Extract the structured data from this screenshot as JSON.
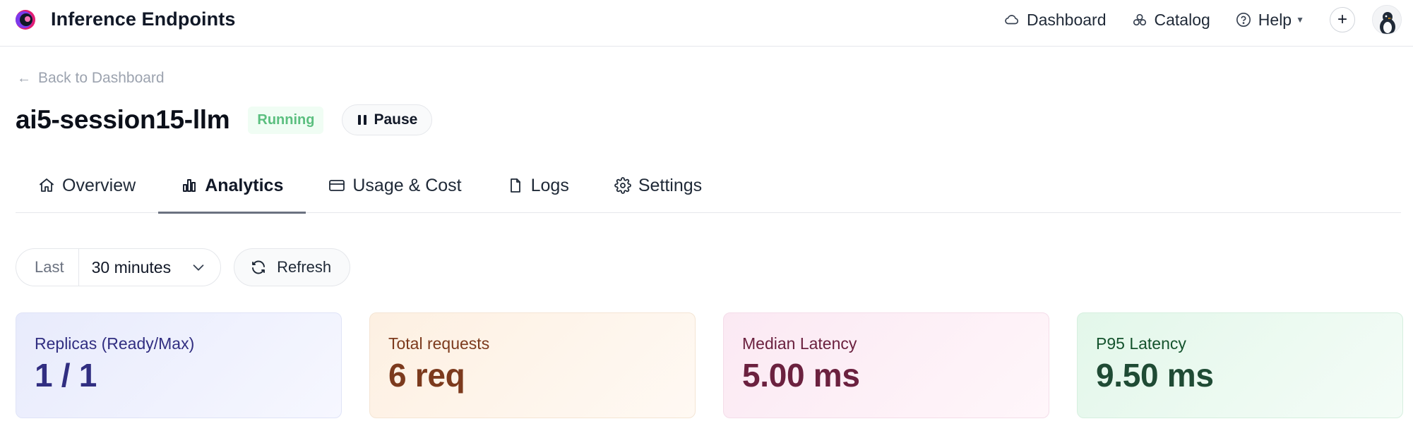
{
  "header": {
    "app_title": "Inference Endpoints",
    "logo_icon": "inference-endpoints-logo",
    "nav": [
      {
        "label": "Dashboard",
        "icon": "cloud-icon"
      },
      {
        "label": "Catalog",
        "icon": "catalog-icon"
      },
      {
        "label": "Help",
        "icon": "help-icon"
      }
    ],
    "add_icon": "plus-icon",
    "avatar_icon": "user-avatar"
  },
  "breadcrumb": {
    "back_label": "Back to Dashboard",
    "arrow": "←"
  },
  "endpoint": {
    "name": "ai5-session15-llm",
    "status": "Running",
    "status_color": "#5bbf7f",
    "pause_label": "Pause"
  },
  "tabs": [
    {
      "label": "Overview",
      "icon": "home-icon",
      "active": false
    },
    {
      "label": "Analytics",
      "icon": "bar-chart-icon",
      "active": true
    },
    {
      "label": "Usage & Cost",
      "icon": "credit-card-icon",
      "active": false
    },
    {
      "label": "Logs",
      "icon": "file-icon",
      "active": false
    },
    {
      "label": "Settings",
      "icon": "gear-icon",
      "active": false
    }
  ],
  "controls": {
    "range_prefix": "Last",
    "range_value": "30 minutes",
    "refresh_label": "Refresh"
  },
  "metrics": [
    {
      "label": "Replicas (Ready/Max)",
      "value": "1 / 1",
      "color": "#312e81"
    },
    {
      "label": "Total requests",
      "value": "6 req",
      "color": "#7c3a1d"
    },
    {
      "label": "Median Latency",
      "value": "5.00 ms",
      "color": "#6b213f"
    },
    {
      "label": "P95 Latency",
      "value": "9.50 ms",
      "color": "#1f4b34"
    }
  ]
}
